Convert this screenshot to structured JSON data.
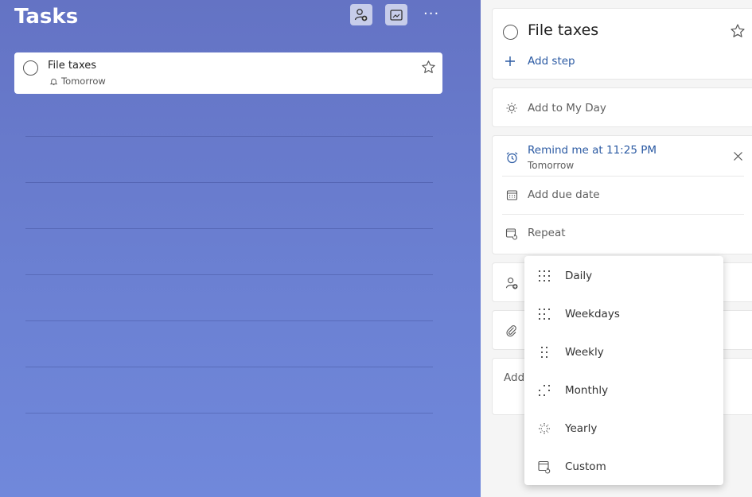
{
  "list": {
    "title": "Tasks",
    "more_label": "···",
    "tasks": [
      {
        "name": "File taxes",
        "reminder": "Tomorrow"
      }
    ]
  },
  "detail": {
    "task_name": "File taxes",
    "add_step": "Add step",
    "my_day": "Add to My Day",
    "reminder_title": "Remind me at 11:25 PM",
    "reminder_sub": "Tomorrow",
    "due_date": "Add due date",
    "repeat": "Repeat",
    "note_placeholder": "Add"
  },
  "repeat_menu": {
    "options": [
      "Daily",
      "Weekdays",
      "Weekly",
      "Monthly",
      "Yearly",
      "Custom"
    ]
  },
  "colors": {
    "accent": "#2b5aa3",
    "gradient_top": "#6473c4",
    "gradient_bottom": "#7088db"
  }
}
